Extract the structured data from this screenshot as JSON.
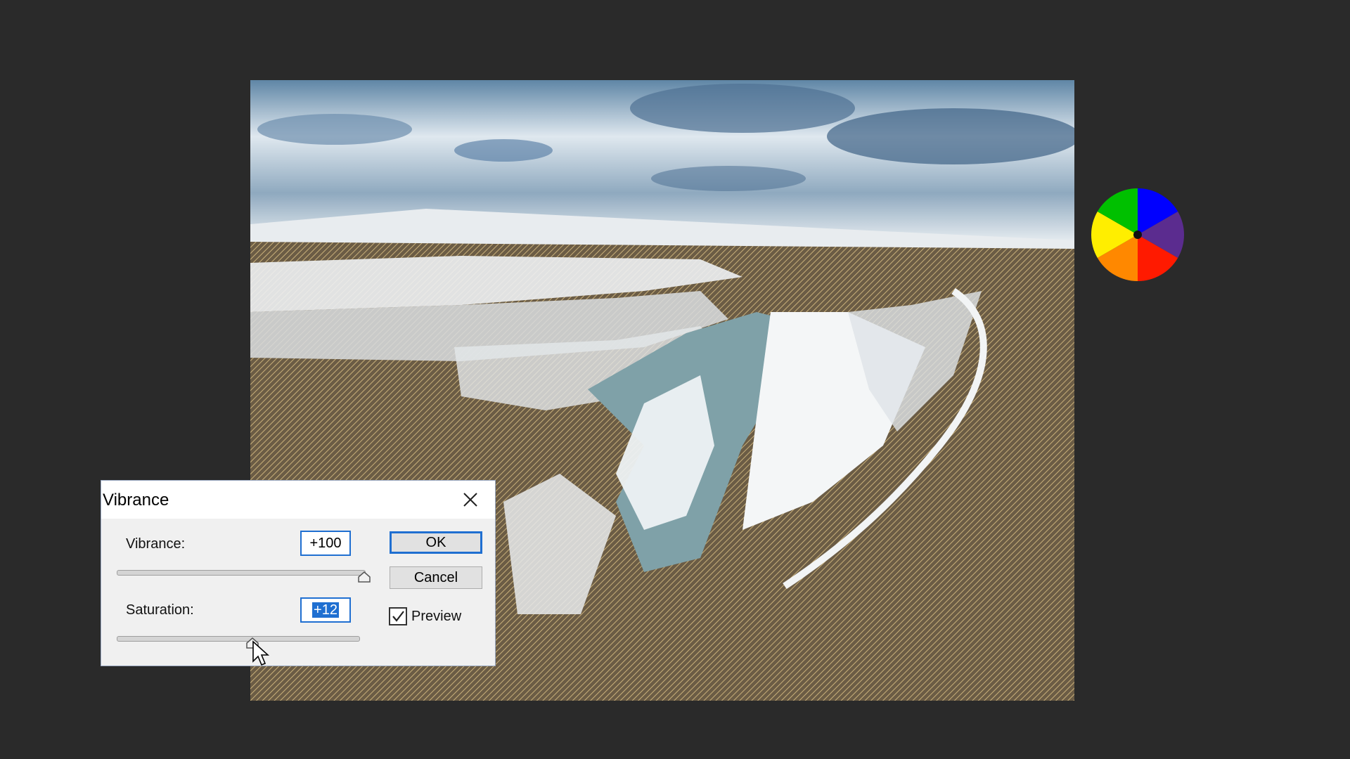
{
  "dialog": {
    "title": "Vibrance",
    "vibrance_label": "Vibrance:",
    "vibrance_value": "+100",
    "saturation_label": "Saturation:",
    "saturation_value": "+12",
    "ok_label": "OK",
    "cancel_label": "Cancel",
    "preview_label": "Preview",
    "preview_checked": true,
    "vibrance_slider_level": 1.0,
    "saturation_slider_level": 0.56
  },
  "icons": {
    "close": "close-icon",
    "checkbox": "checkmark-icon",
    "cursor": "mouse-pointer-icon",
    "wheel": "color-wheel-icon"
  },
  "colors": {
    "accent": "#1f6fd1",
    "background": "#2a2a2a",
    "wheel": [
      "#0000ff",
      "#5b2c8f",
      "#ff1a00",
      "#ff8800",
      "#ffee00",
      "#00c000"
    ]
  }
}
